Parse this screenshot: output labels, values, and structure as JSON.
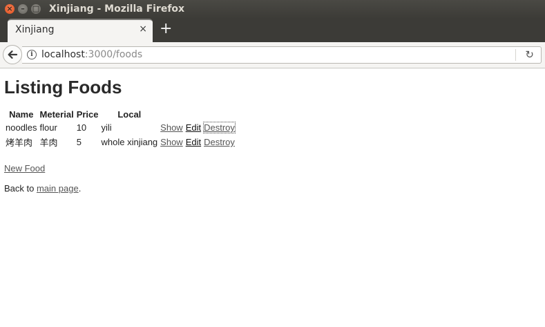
{
  "window": {
    "title": "Xinjiang - Mozilla Firefox",
    "close_glyph": "×",
    "min_glyph": "–",
    "max_glyph": "□"
  },
  "tab": {
    "title": "Xinjiang",
    "close_glyph": "×",
    "new_tab_glyph": "+"
  },
  "navbar": {
    "back_glyph": "←",
    "info_glyph": "i",
    "url_host": "localhost",
    "url_rest": ":3000/foods",
    "reload_glyph": "↻"
  },
  "page": {
    "heading": "Listing Foods",
    "columns": [
      "Name",
      "Meterial",
      "Price",
      "Local"
    ],
    "rows": [
      {
        "name": "noodles",
        "material": "flour",
        "price": "10",
        "local": "yili",
        "show": "Show",
        "edit": "Edit",
        "destroy": "Destroy"
      },
      {
        "name": "烤羊肉",
        "material": "羊肉",
        "price": "5",
        "local": "whole xinjiang",
        "show": "Show",
        "edit": "Edit",
        "destroy": "Destroy"
      }
    ],
    "new_food_link": "New Food",
    "back_prefix": "Back to ",
    "back_link": "main page",
    "back_suffix": "."
  },
  "colors": {
    "titlebar": "#3c3b37",
    "close_button": "#e2501c",
    "link": "#555555"
  },
  "icons": [
    "close-window-icon",
    "minimize-window-icon",
    "maximize-window-icon",
    "tab-close-icon",
    "new-tab-icon",
    "back-arrow-icon",
    "info-icon",
    "reload-icon"
  ]
}
